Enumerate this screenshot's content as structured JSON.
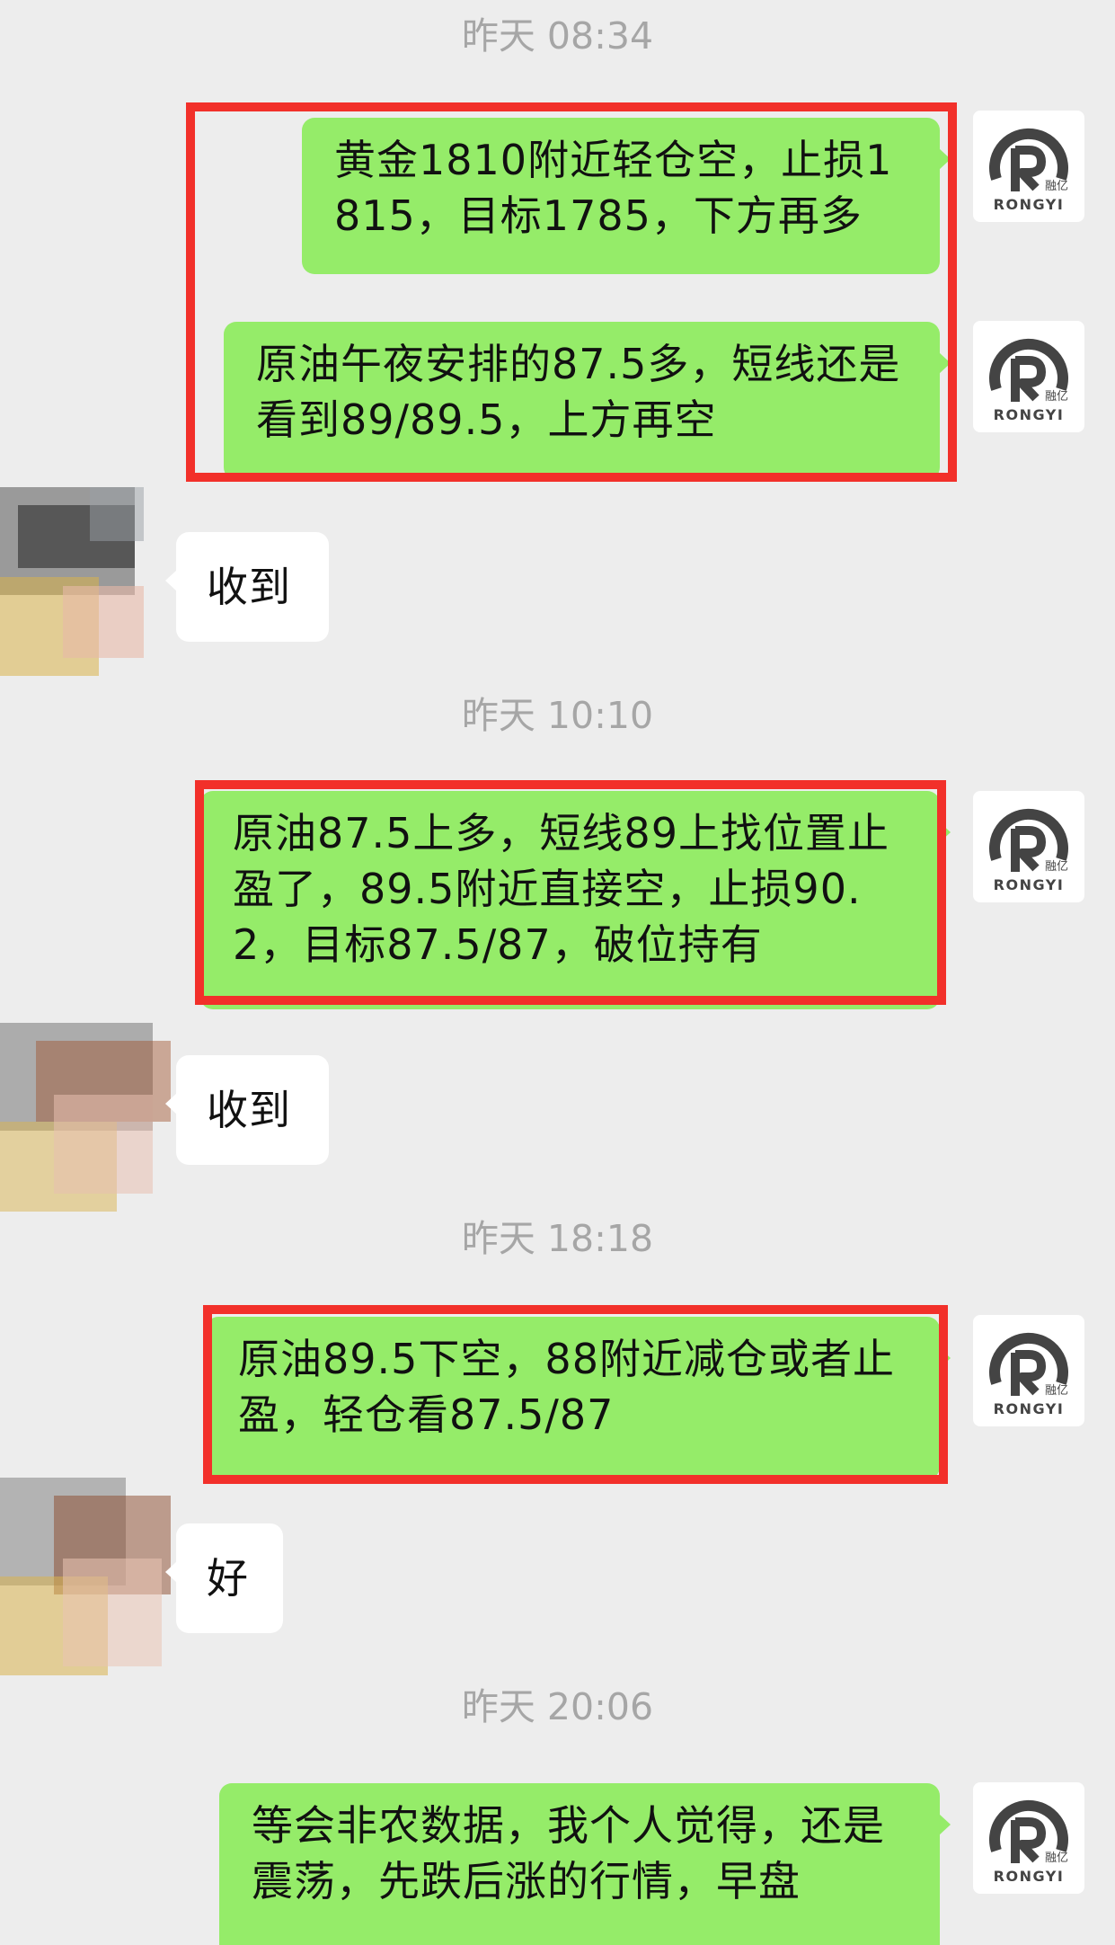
{
  "timestamps": [
    "昨天 08:34",
    "昨天 10:10",
    "昨天 18:18",
    "昨天 20:06"
  ],
  "messages": [
    {
      "from": "me",
      "text": "黄金1810附近轻仓空，止损1815，目标1785，下方再多",
      "highlighted": true
    },
    {
      "from": "me",
      "text": "原油午夜安排的87.5多，短线还是看到89/89.5，上方再空",
      "highlighted": true
    },
    {
      "from": "other",
      "text": "收到"
    },
    {
      "from": "me",
      "text": "原油87.5上多，短线89上找位置止盈了，89.5附近直接空，止损90.2，目标87.5/87，破位持有",
      "highlighted": true
    },
    {
      "from": "other",
      "text": "收到"
    },
    {
      "from": "me",
      "text": "原油89.5下空，88附近减仓或者止盈，轻仓看87.5/87",
      "highlighted": true
    },
    {
      "from": "other",
      "text": "好"
    },
    {
      "from": "me",
      "text": "等会非农数据，我个人觉得，还是震荡，先跌后涨的行情，早盘"
    }
  ],
  "avatar_logo": {
    "brand": "RONGYI",
    "mark": "融亿",
    "icon": "rongyi-logo-icon"
  },
  "colors": {
    "background": "#EDEDED",
    "outgoing_bubble": "#95EC69",
    "incoming_bubble": "#FFFFFF",
    "highlight_box": "#F2302A",
    "timestamp": "#A6A6A6"
  }
}
